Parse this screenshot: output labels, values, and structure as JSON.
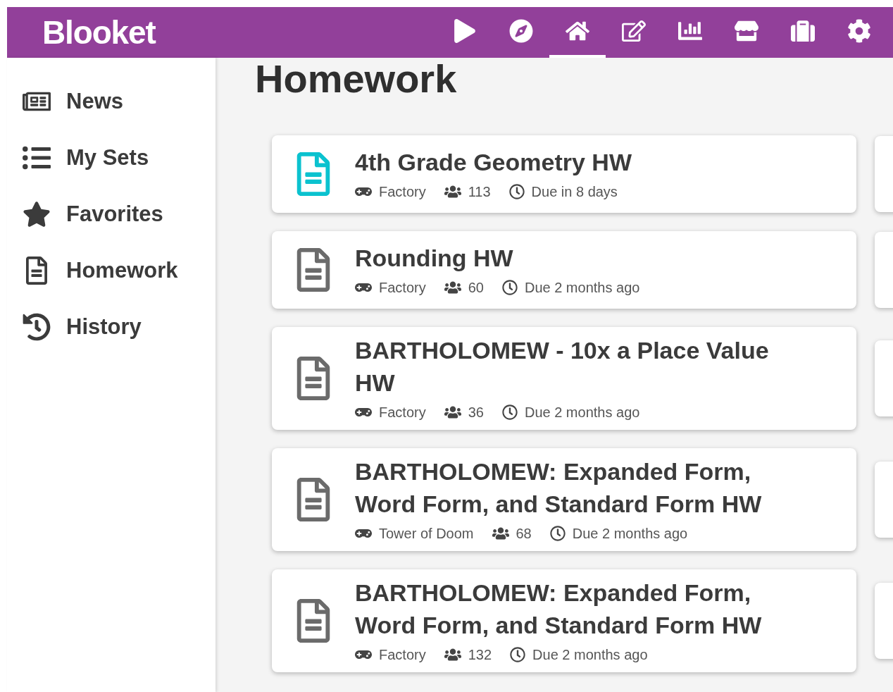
{
  "header": {
    "logo": "Blooket",
    "nav": [
      {
        "selected": false
      },
      {
        "selected": false
      },
      {
        "selected": true
      },
      {
        "selected": false
      },
      {
        "selected": false
      },
      {
        "selected": false
      },
      {
        "selected": false
      },
      {
        "selected": false
      }
    ]
  },
  "sidebar": {
    "items": [
      {
        "label": "News"
      },
      {
        "label": "My Sets"
      },
      {
        "label": "Favorites"
      },
      {
        "label": "Homework"
      },
      {
        "label": "History"
      }
    ]
  },
  "page_title": "Homework",
  "homework": [
    {
      "title": "4th Grade Geometry HW",
      "active": true,
      "mode": "Factory",
      "players": "113",
      "due": "Due in 8 days"
    },
    {
      "title": "Rounding HW",
      "active": false,
      "mode": "Factory",
      "players": "60",
      "due": "Due 2 months ago"
    },
    {
      "title": "BARTHOLOMEW - 10x a Place Value HW",
      "active": false,
      "mode": "Factory",
      "players": "36",
      "due": "Due 2 months ago"
    },
    {
      "title": "BARTHOLOMEW: Expanded Form, Word Form, and Standard Form HW",
      "active": false,
      "mode": "Tower of Doom",
      "players": "68",
      "due": "Due 2 months ago"
    },
    {
      "title": "BARTHOLOMEW: Expanded Form, Word Form, and Standard Form HW",
      "active": false,
      "mode": "Factory",
      "players": "132",
      "due": "Due 2 months ago"
    }
  ]
}
